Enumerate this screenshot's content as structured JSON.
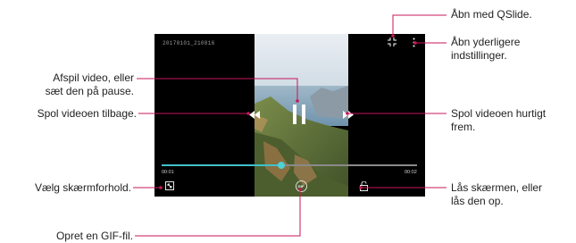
{
  "player": {
    "filename": "20170101_210816",
    "time_elapsed": "00:01",
    "time_total": "00:02",
    "progress": 0.47,
    "gif_label": "GIF",
    "accent_color": "#3fc1c9"
  },
  "callouts": {
    "qslide": "Åbn med QSlide.",
    "more_settings": [
      "Åbn yderligere",
      "indstillinger."
    ],
    "play_pause": [
      "Afspil video, eller",
      "sæt den på pause."
    ],
    "rewind": "Spol videoen tilbage.",
    "fast_forward": [
      "Spol videoen hurtigt",
      "frem."
    ],
    "aspect_ratio": "Vælg skærmforhold.",
    "lock_screen": [
      "Lås skærmen, eller",
      "lås den op."
    ],
    "create_gif": "Opret en GIF-fil."
  },
  "colors": {
    "leader_line": "#c8155a",
    "leader_dot": "#c8155a"
  }
}
